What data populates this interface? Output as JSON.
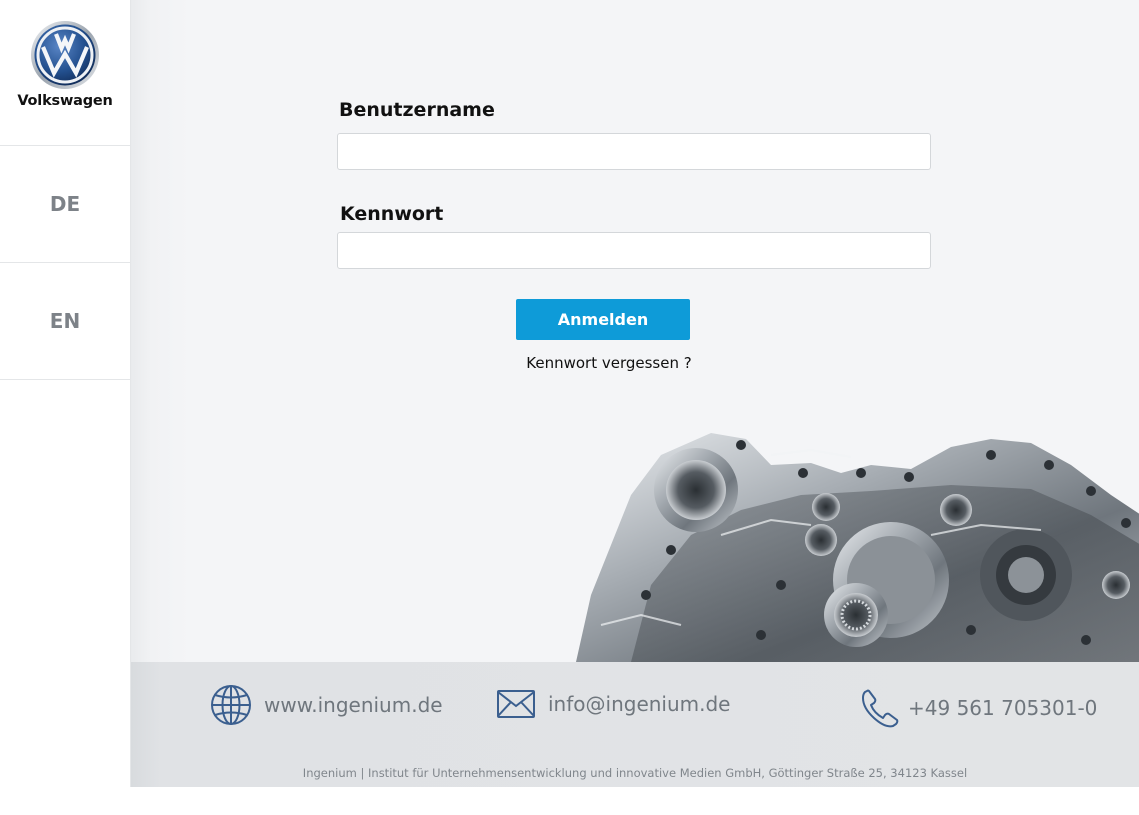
{
  "brand": {
    "name": "Volkswagen"
  },
  "sidebar": {
    "languages": [
      {
        "code": "DE"
      },
      {
        "code": "EN"
      }
    ]
  },
  "login": {
    "username_label": "Benutzername",
    "username_value": "",
    "password_label": "Kennwort",
    "password_value": "",
    "submit_label": "Anmelden",
    "forgot_label": "Kennwort vergessen ?"
  },
  "footer": {
    "website": "www.ingenium.de",
    "email": "info@ingenium.de",
    "phone": "+49 561 705301-0",
    "legal": "Ingenium | Institut für Unternehmensentwicklung und innovative Medien GmbH, Göttinger Straße 25, 34123 Kassel"
  },
  "colors": {
    "accent": "#0e9bd8",
    "vw_blue": "#1b3f7a",
    "icon_blue": "#3b5f8f"
  },
  "icons": {
    "globe": "globe-icon",
    "mail": "mail-icon",
    "phone": "phone-icon",
    "logo": "volkswagen-logo-icon"
  }
}
